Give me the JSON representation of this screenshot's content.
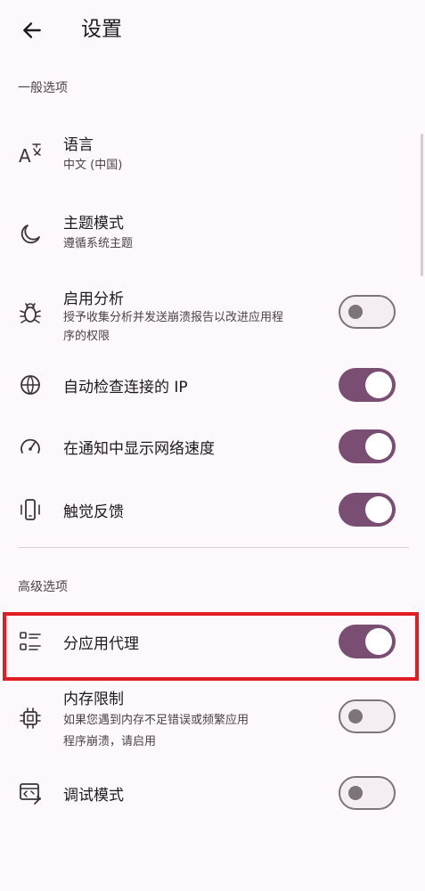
{
  "app_bar": {
    "title": "设置",
    "back_icon": "arrow-left-icon"
  },
  "sections": [
    {
      "header": "一般选项"
    },
    {
      "header": "高级选项"
    }
  ],
  "general": {
    "language": {
      "title": "语言",
      "subtitle": "中文 (中国)",
      "icon": "translate-icon"
    },
    "theme": {
      "title": "主题模式",
      "subtitle": "遵循系统主题",
      "icon": "moon-icon"
    },
    "analytics": {
      "title": "启用分析",
      "subtitle_line1": "授予收集分析并发送崩溃报告以改进应用程",
      "subtitle_line2": "序的权限",
      "enabled": false,
      "icon": "bug-icon"
    },
    "auto_check_ip": {
      "title": "自动检查连接的 IP",
      "enabled": true,
      "icon": "globe-icon"
    },
    "network_speed": {
      "title": "在通知中显示网络速度",
      "enabled": true,
      "icon": "speedometer-icon"
    },
    "haptic": {
      "title": "触觉反馈",
      "enabled": true,
      "icon": "phone-vibrate-icon"
    }
  },
  "advanced": {
    "per_app_proxy": {
      "title": "分应用代理",
      "enabled": true,
      "icon": "list-icon"
    },
    "memory_limit": {
      "title": "内存限制",
      "subtitle_line1": "如果您遇到内存不足错误或频繁应用",
      "subtitle_line2": "程序崩溃，请启用",
      "enabled": false,
      "icon": "chip-icon"
    },
    "debug_mode": {
      "title": "调试模式",
      "enabled": false,
      "icon": "debug-code-icon"
    }
  },
  "colors": {
    "switch_on": "#7a4d72",
    "switch_off_border": "#7c7479",
    "highlight": "#e11d24",
    "background": "#fdf8fb"
  }
}
